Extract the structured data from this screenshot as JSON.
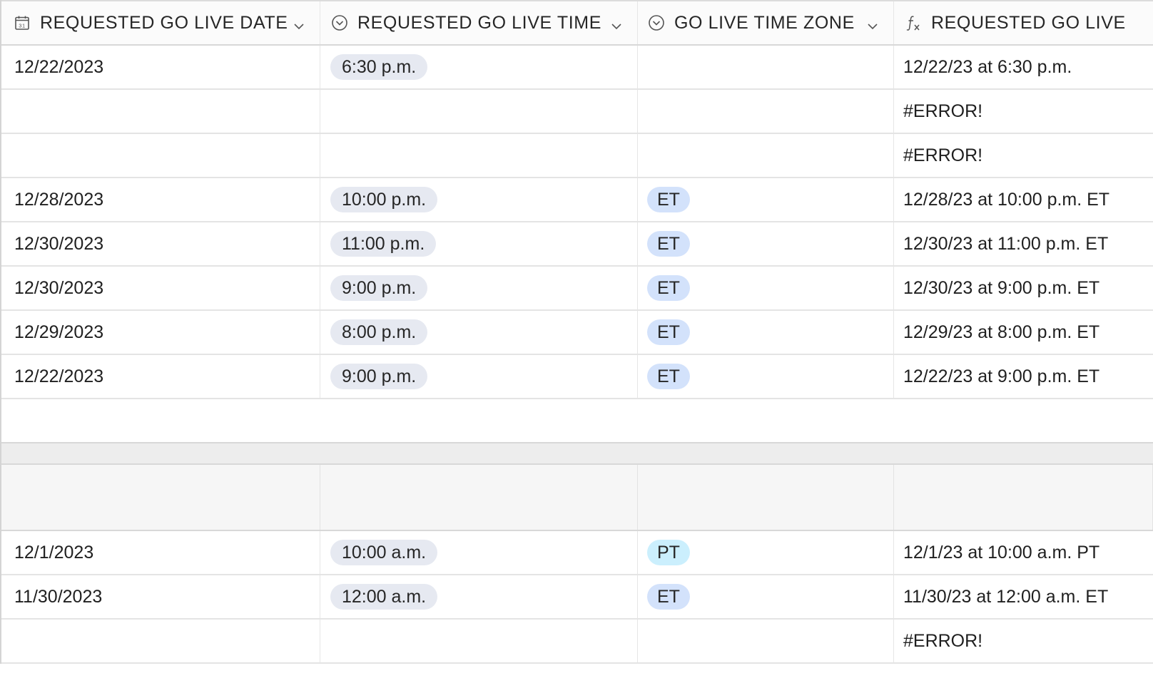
{
  "columns": [
    {
      "label": "REQUESTED GO LIVE DATE",
      "icon": "calendar-icon"
    },
    {
      "label": "REQUESTED GO LIVE TIME",
      "icon": "single-select-icon"
    },
    {
      "label": "GO LIVE TIME ZONE",
      "icon": "single-select-icon"
    },
    {
      "label": "REQUESTED GO LIVE",
      "icon": "formula-icon"
    }
  ],
  "group1": {
    "rows": [
      {
        "date": "12/22/2023",
        "time": "6:30 p.m.",
        "tz": "",
        "combined": "12/22/23 at 6:30 p.m."
      },
      {
        "date": "",
        "time": "",
        "tz": "",
        "combined": "#ERROR!"
      },
      {
        "date": "",
        "time": "",
        "tz": "",
        "combined": "#ERROR!"
      },
      {
        "date": "12/28/2023",
        "time": "10:00 p.m.",
        "tz": "ET",
        "combined": "12/28/23 at 10:00 p.m. ET"
      },
      {
        "date": "12/30/2023",
        "time": "11:00 p.m.",
        "tz": "ET",
        "combined": "12/30/23 at 11:00 p.m. ET"
      },
      {
        "date": "12/30/2023",
        "time": "9:00 p.m.",
        "tz": "ET",
        "combined": "12/30/23 at 9:00 p.m. ET"
      },
      {
        "date": "12/29/2023",
        "time": "8:00 p.m.",
        "tz": "ET",
        "combined": "12/29/23 at 8:00 p.m. ET"
      },
      {
        "date": "12/22/2023",
        "time": "9:00 p.m.",
        "tz": "ET",
        "combined": "12/22/23 at 9:00 p.m. ET"
      }
    ]
  },
  "group2": {
    "rows": [
      {
        "date": "12/1/2023",
        "time": "10:00 a.m.",
        "tz": "PT",
        "combined": "12/1/23 at 10:00 a.m. PT"
      },
      {
        "date": "11/30/2023",
        "time": "12:00 a.m.",
        "tz": "ET",
        "combined": "11/30/23 at 12:00 a.m. ET"
      },
      {
        "date": "",
        "time": "",
        "tz": "",
        "combined": "#ERROR!"
      }
    ]
  },
  "colors": {
    "time_pill": "#e6e9f1",
    "tz_et_pill": "#d3e2fb",
    "tz_pt_pill": "#cbeffd"
  }
}
